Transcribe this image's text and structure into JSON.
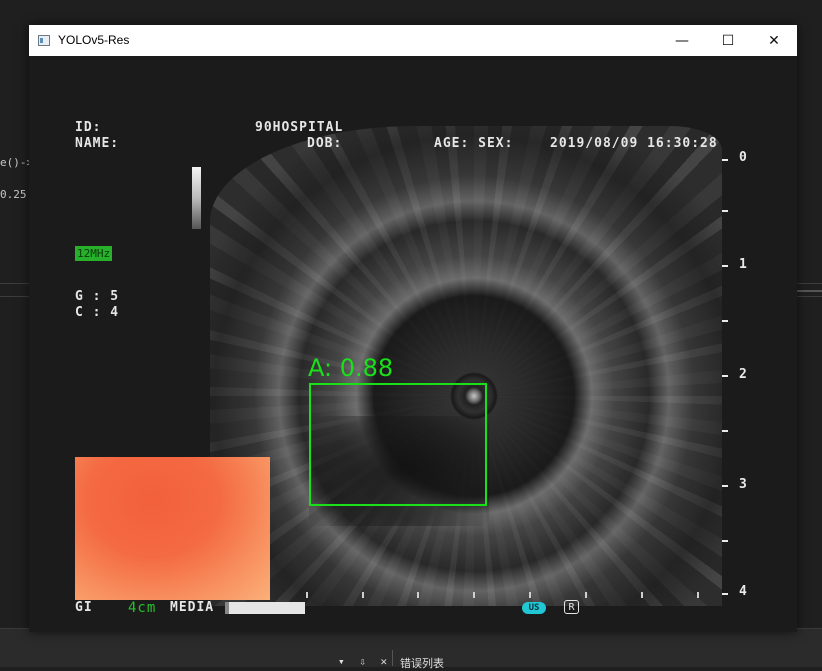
{
  "window": {
    "title": "YOLOv5-Res",
    "minimize_glyph": "—",
    "maximize_glyph": "☐",
    "close_glyph": "✕"
  },
  "background": {
    "code_fragment_1": "e()->",
    "code_fragment_2": "0.25",
    "bottom_panel_tools": "▾ ⇩ ✕",
    "bottom_panel_tab": "错误列表"
  },
  "osd": {
    "id_label": "ID:",
    "name_label": "NAME:",
    "hospital": "90HOSPITAL",
    "dob_label": "DOB:",
    "age_sex_label": "AGE: SEX:",
    "datetime": "2019/08/09 16:30:28",
    "frequency": "12MHz",
    "gain": "G : 5",
    "contrast": "C : 4",
    "mode": "GI",
    "range": "4cm",
    "media_label": "MEDIA",
    "us_badge": "US",
    "r_badge": "R"
  },
  "depth_scale": [
    "0",
    "1",
    "2",
    "3",
    "4"
  ],
  "detection": {
    "label": "A: 0.88",
    "class": "A",
    "confidence": 0.88,
    "color": "#19e019"
  },
  "colors": {
    "frequency_badge": "#27b02a",
    "us_badge": "#22c7d6"
  }
}
